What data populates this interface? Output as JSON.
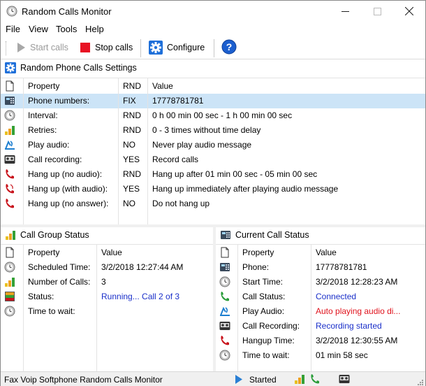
{
  "window": {
    "title": "Random Calls Monitor"
  },
  "menu": [
    "File",
    "View",
    "Tools",
    "Help"
  ],
  "toolbar": {
    "start_label": "Start calls",
    "stop_label": "Stop calls",
    "configure_label": "Configure"
  },
  "settings": {
    "title": "Random Phone Calls Settings",
    "headers": {
      "property": "Property",
      "rnd": "RND",
      "value": "Value"
    },
    "rows": [
      {
        "icon": "phone-icon",
        "property": "Phone numbers:",
        "rnd": "FIX",
        "value": "17778781781"
      },
      {
        "icon": "clock-icon",
        "property": "Interval:",
        "rnd": "RND",
        "value": "0 h 00 min 00 sec - 1 h 00 min 00 sec"
      },
      {
        "icon": "bars-icon",
        "property": "Retries:",
        "rnd": "RND",
        "value": "0 - 3 times without time delay"
      },
      {
        "icon": "audio-icon",
        "property": "Play audio:",
        "rnd": "NO",
        "value": "Never play audio message"
      },
      {
        "icon": "tape-icon",
        "property": "Call recording:",
        "rnd": "YES",
        "value": "Record calls"
      },
      {
        "icon": "hangup-icon",
        "property": "Hang up (no audio):",
        "rnd": "RND",
        "value": "Hang up after 01 min 00 sec - 05 min 00 sec"
      },
      {
        "icon": "hangup-audio-icon",
        "property": "Hang up (with audio):",
        "rnd": "YES",
        "value": "Hang up immediately after playing audio message"
      },
      {
        "icon": "hangup-icon",
        "property": "Hang up (no answer):",
        "rnd": "NO",
        "value": "Do not hang up"
      }
    ]
  },
  "group_status": {
    "title": "Call Group Status",
    "headers": {
      "property": "Property",
      "value": "Value"
    },
    "rows": [
      {
        "icon": "clock-icon",
        "property": "Scheduled Time:",
        "value": "3/2/2018 12:27:44 AM",
        "style": ""
      },
      {
        "icon": "bars-icon",
        "property": "Number of Calls:",
        "value": "3",
        "style": ""
      },
      {
        "icon": "status-icon",
        "property": "Status:",
        "value": "Running... Call 2 of 3",
        "style": "blue"
      },
      {
        "icon": "clock-icon",
        "property": "Time to wait:",
        "value": "",
        "style": ""
      }
    ]
  },
  "call_status": {
    "title": "Current Call Status",
    "headers": {
      "property": "Property",
      "value": "Value"
    },
    "rows": [
      {
        "icon": "phone-icon",
        "property": "Phone:",
        "value": "17778781781",
        "style": ""
      },
      {
        "icon": "clock-icon",
        "property": "Start Time:",
        "value": "3/2/2018 12:28:23 AM",
        "style": ""
      },
      {
        "icon": "green-handset-icon",
        "property": "Call Status:",
        "value": "Connected",
        "style": "blue"
      },
      {
        "icon": "audio-icon",
        "property": "Play Audio:",
        "value": "Auto playing audio di...",
        "style": "red"
      },
      {
        "icon": "tape-icon",
        "property": "Call Recording:",
        "value": "Recording started",
        "style": "blue"
      },
      {
        "icon": "hangup-icon",
        "property": "Hangup Time:",
        "value": "3/2/2018 12:30:55 AM",
        "style": ""
      },
      {
        "icon": "clock-icon",
        "property": "Time to wait:",
        "value": "01 min 58 sec",
        "style": ""
      }
    ]
  },
  "statusbar": {
    "app_text": "Fax Voip Softphone Random Calls Monitor",
    "state_text": "Started"
  },
  "colors": {
    "selection": "#cce4f7",
    "accent_blue": "#1a2fc9",
    "accent_red": "#e0141e",
    "stop_red": "#e81123"
  }
}
